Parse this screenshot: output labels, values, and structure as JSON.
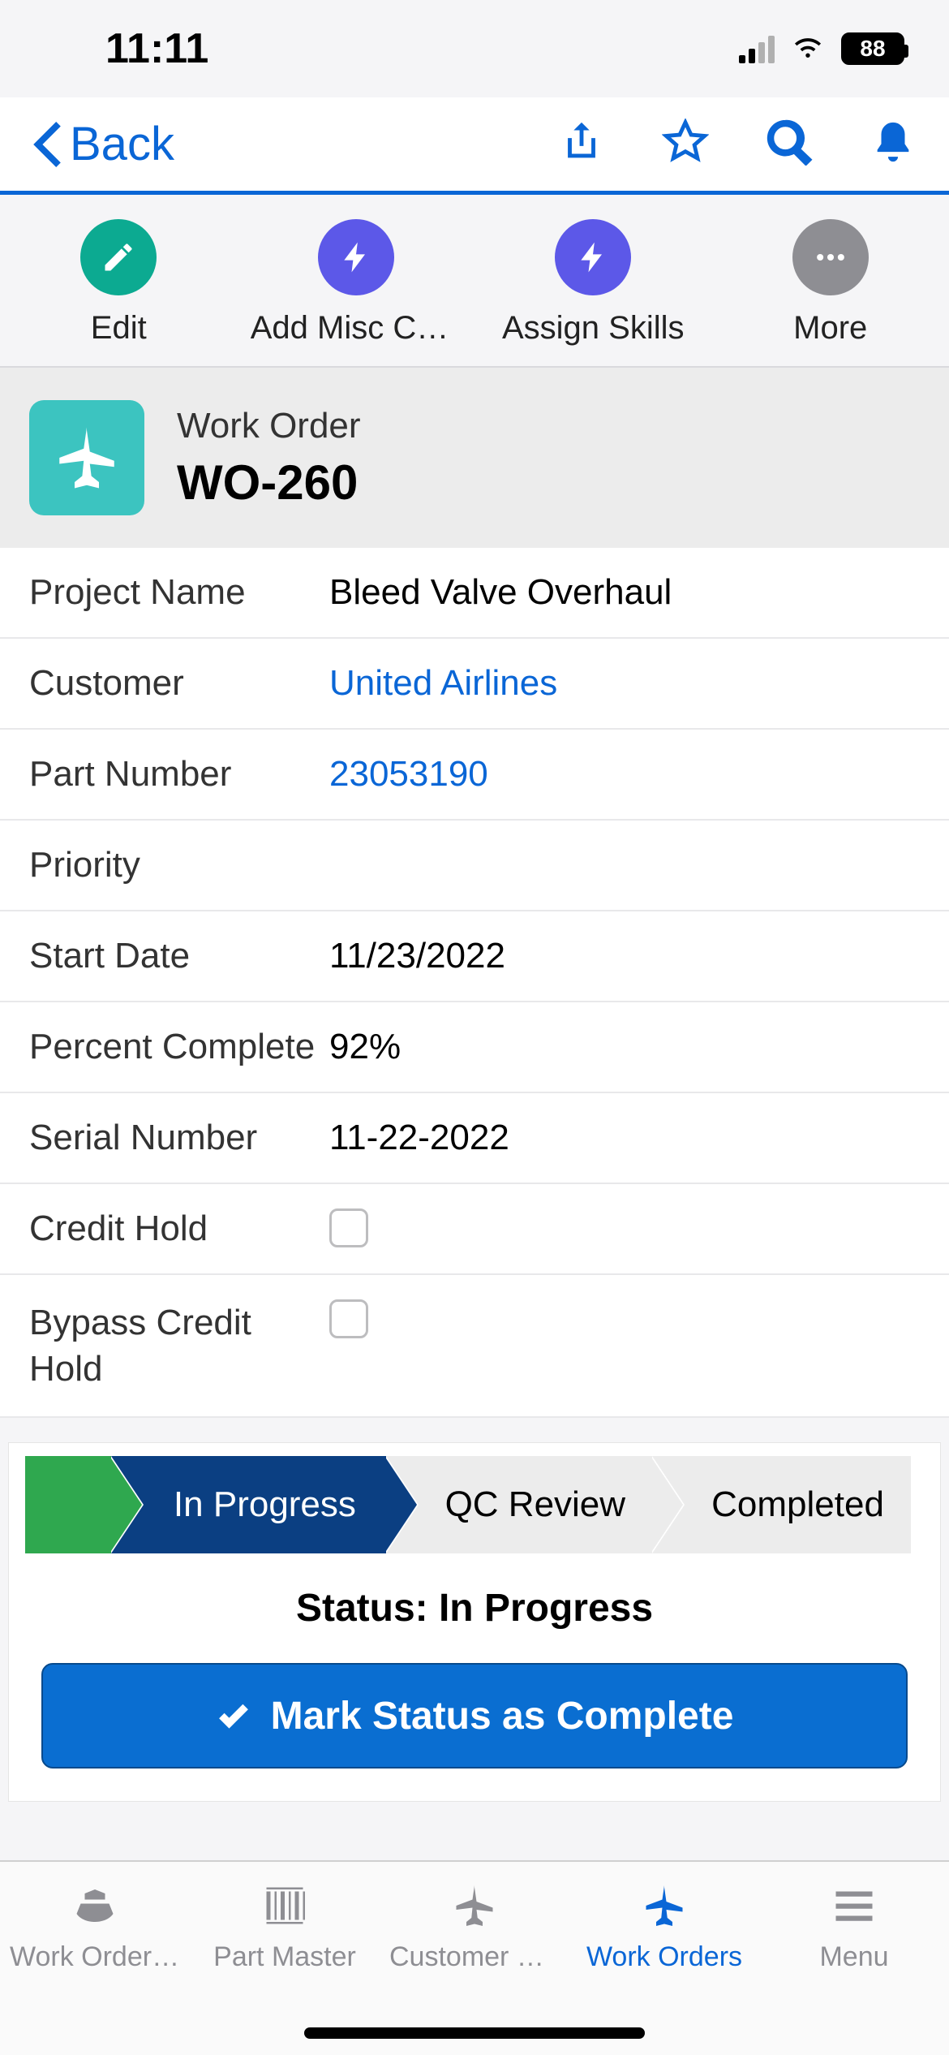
{
  "status_bar": {
    "time": "11:11",
    "battery_pct": "88"
  },
  "nav": {
    "back_label": "Back"
  },
  "actions": {
    "edit": "Edit",
    "add_misc": "Add Misc Charg…",
    "assign_skills": "Assign Skills",
    "more": "More"
  },
  "header": {
    "type_label": "Work Order",
    "wo_id": "WO-260"
  },
  "fields": {
    "project_name": {
      "label": "Project Name",
      "value": "Bleed Valve Overhaul"
    },
    "customer": {
      "label": "Customer",
      "value": "United Airlines"
    },
    "part_number": {
      "label": "Part Number",
      "value": "23053190"
    },
    "priority": {
      "label": "Priority",
      "value": ""
    },
    "start_date": {
      "label": "Start Date",
      "value": "11/23/2022"
    },
    "percent_complete": {
      "label": "Percent Complete",
      "value": "92%"
    },
    "serial_number": {
      "label": "Serial Number",
      "value": "11-22-2022"
    },
    "credit_hold": {
      "label": "Credit Hold",
      "checked": false
    },
    "bypass_credit_hold": {
      "label": "Bypass Credit Hold",
      "checked": false
    }
  },
  "status": {
    "stages": {
      "s0": "",
      "s1": "In Progress",
      "s2": "QC Review",
      "s3": "Completed"
    },
    "current_label": "Status: In Progress",
    "button_label": "Mark Status as Complete"
  },
  "tabs": {
    "t1": "Work Order To…",
    "t2": "Part Master",
    "t3": "Customer Quot…",
    "t4": "Work Orders",
    "t5": "Menu"
  }
}
